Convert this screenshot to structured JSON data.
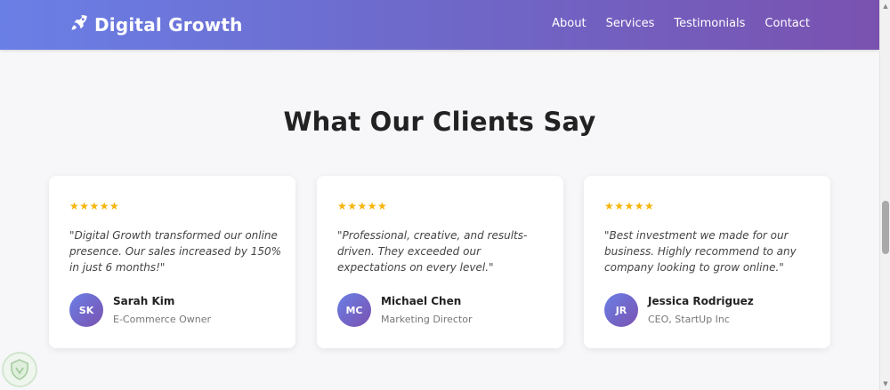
{
  "header": {
    "brand_name": "Digital Growth",
    "brand_icon": "rocket-icon",
    "nav": [
      {
        "label": "About"
      },
      {
        "label": "Services"
      },
      {
        "label": "Testimonials"
      },
      {
        "label": "Contact"
      }
    ]
  },
  "testimonials": {
    "title": "What Our Clients Say",
    "items": [
      {
        "stars": "★★★★★",
        "rating": 5,
        "quote": "\"Digital Growth transformed our online presence. Our sales increased by 150% in just 6 months!\"",
        "initials": "SK",
        "name": "Sarah Kim",
        "role": "E-Commerce Owner"
      },
      {
        "stars": "★★★★★",
        "rating": 5,
        "quote": "\"Professional, creative, and results-driven. They exceeded our expectations on every level.\"",
        "initials": "MC",
        "name": "Michael Chen",
        "role": "Marketing Director"
      },
      {
        "stars": "★★★★★",
        "rating": 5,
        "quote": "\"Best investment we made for our business. Highly recommend to any company looking to grow online.\"",
        "initials": "JR",
        "name": "Jessica Rodriguez",
        "role": "CEO, StartUp Inc"
      }
    ]
  },
  "colors": {
    "gradient_start": "#6a7fe6",
    "gradient_end": "#7a52b0",
    "star": "#f6b40a",
    "heading": "#222222"
  }
}
